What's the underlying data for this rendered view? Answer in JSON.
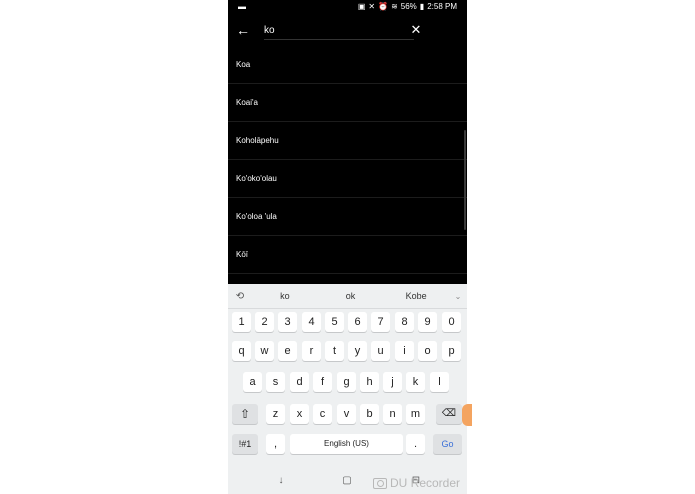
{
  "status_bar": {
    "battery": "56%",
    "time": "2:58 PM"
  },
  "search": {
    "value": "ko"
  },
  "results": [
    "Koa",
    "Koai'a",
    "Koholāpehu",
    "Ko'oko'olau",
    "Ko'oloa 'ula",
    "Kōī"
  ],
  "keyboard": {
    "suggestions": [
      "ko",
      "ok",
      "Kobe"
    ],
    "row_numbers": [
      "1",
      "2",
      "3",
      "4",
      "5",
      "6",
      "7",
      "8",
      "9",
      "0"
    ],
    "row1": [
      "q",
      "w",
      "e",
      "r",
      "t",
      "y",
      "u",
      "i",
      "o",
      "p"
    ],
    "row2": [
      "a",
      "s",
      "d",
      "f",
      "g",
      "h",
      "j",
      "k",
      "l"
    ],
    "row3": [
      "z",
      "x",
      "c",
      "v",
      "b",
      "n",
      "m"
    ],
    "symbols_label": "!#1",
    "comma_label": ",",
    "space_label": "English (US)",
    "period_label": ".",
    "go_label": "Go"
  },
  "watermark": "DU Recorder"
}
